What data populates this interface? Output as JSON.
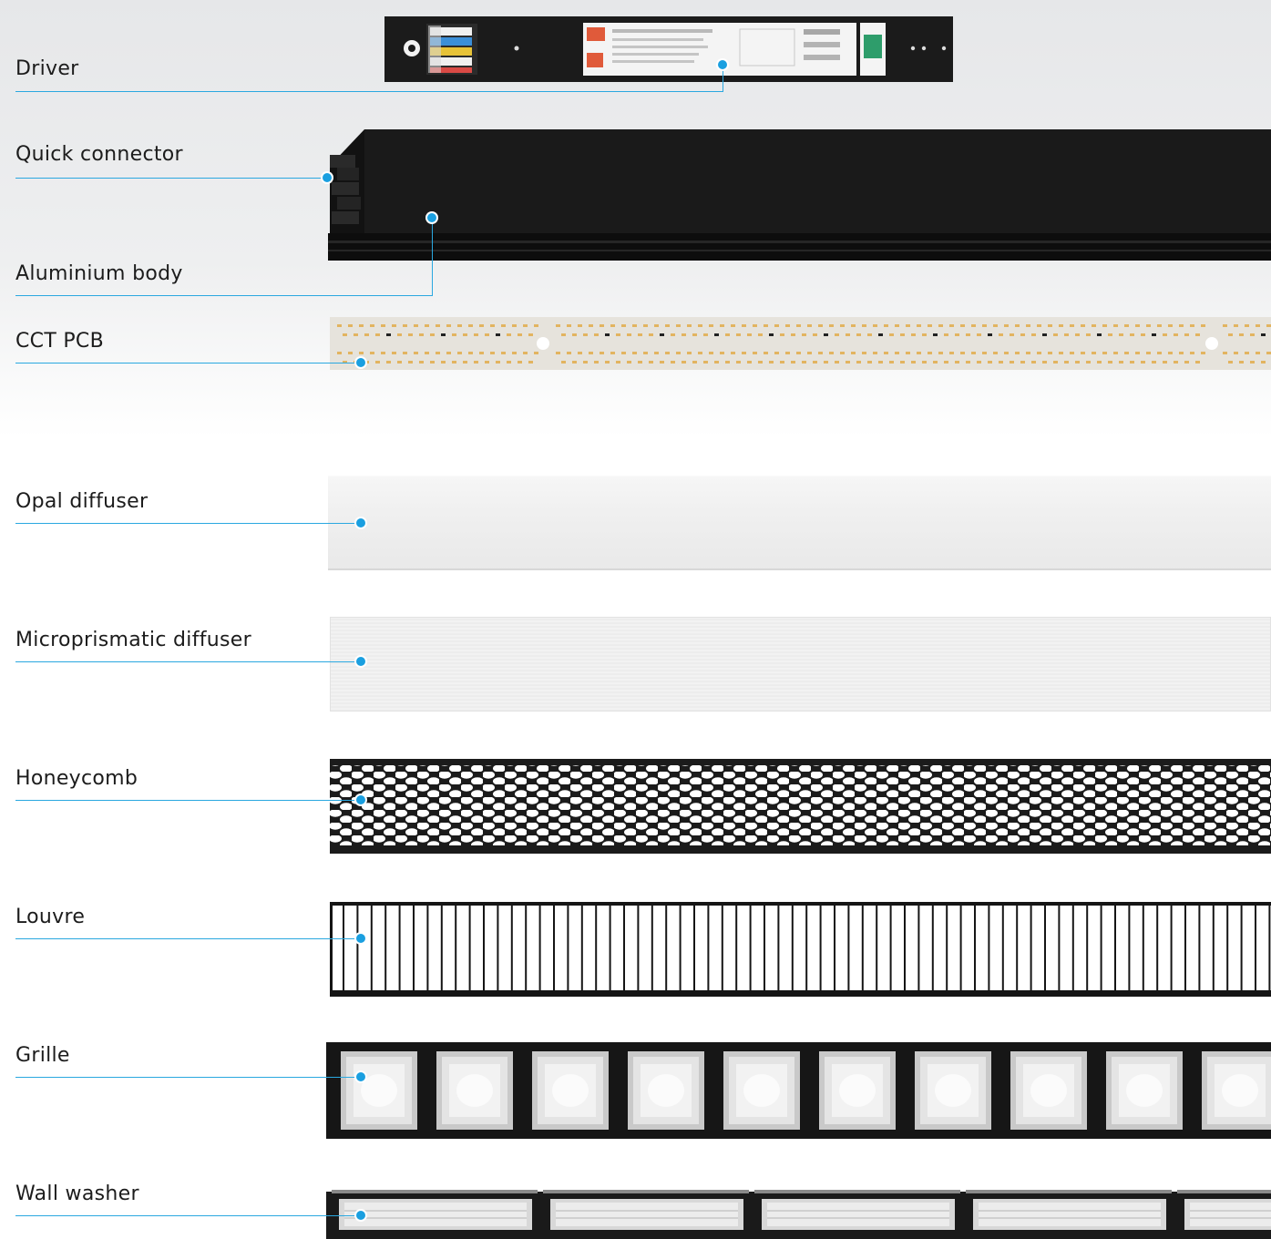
{
  "labels": {
    "driver": "Driver",
    "quick_connector": "Quick connector",
    "aluminium_body": "Aluminium body",
    "cct_pcb": "CCT PCB",
    "opal_diffuser": "Opal diffuser",
    "microprismatic_diffuser": "Microprismatic diffuser",
    "honeycomb": "Honeycomb",
    "louvre": "Louvre",
    "grille": "Grille",
    "wall_washer": "Wall washer"
  },
  "colors": {
    "leader": "#2aa8e0",
    "dot": "#1a9fe0",
    "body_black": "#141414",
    "led_amber": "#e2b460"
  },
  "icons": {
    "callout": "dot-icon"
  }
}
